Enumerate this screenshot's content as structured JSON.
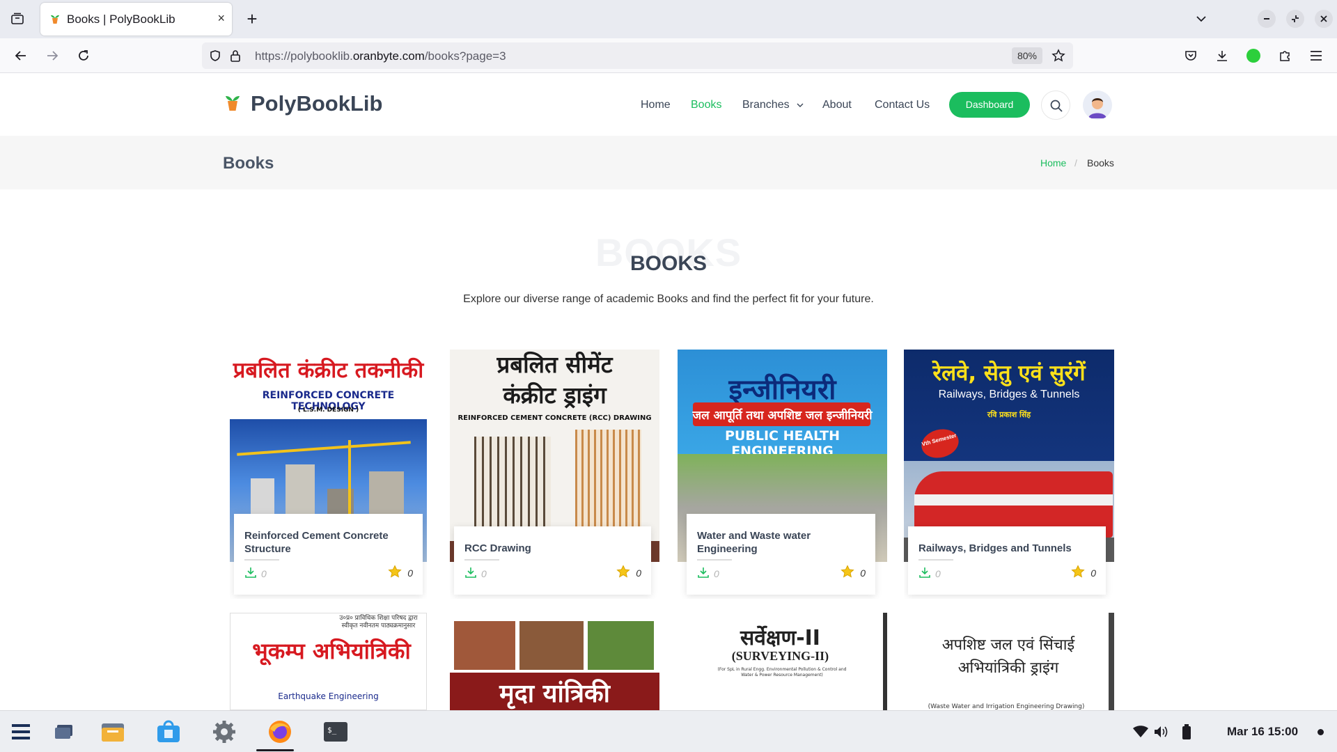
{
  "browser": {
    "tab_title": "Books | PolyBookLib",
    "tab_close": "×",
    "new_tab": "+",
    "url_prefix": "https://polybooklib.",
    "url_domain": "oranbyte.com",
    "url_path": "/books?page=3",
    "zoom": "80%"
  },
  "site": {
    "brand": "PolyBookLib",
    "nav": [
      "Home",
      "Books",
      "Branches",
      "About",
      "Contact Us"
    ],
    "active_nav": "Books",
    "dashboard_label": "Dashboard",
    "accent": "#1bbd5e"
  },
  "page": {
    "title": "Books",
    "breadcrumb": {
      "home": "Home",
      "sep": "/",
      "current": "Books"
    },
    "section_ghost": "BOOKS",
    "section_title": "BOOKS",
    "section_subtitle": "Explore our diverse range of academic Books and find the perfect fit for your future."
  },
  "books": [
    {
      "title": "Reinforced Cement Concrete Structure",
      "downloads": "0",
      "stars": "0",
      "cover_hindi": "प्रबलित कंक्रीट तकनीकी",
      "cover_english": "REINFORCED CONCRETE TECHNOLOGY",
      "cover_sub": "( L.S.M. DESIGN )"
    },
    {
      "title": "RCC Drawing",
      "downloads": "0",
      "stars": "0",
      "cover_hindi": "प्रबलित सीमेंट कंक्रीट ड्राइंग",
      "cover_english": "REINFORCED CEMENT CONCRETE (RCC) DRAWING"
    },
    {
      "title": "Water and Waste water Engineering",
      "downloads": "0",
      "stars": "0",
      "cover_hindi": "इन्जीनियरी",
      "cover_hindi2": "जल आपूर्ति तथा अपशिष्ट जल इन्जीनियरी",
      "cover_english": "PUBLIC HEALTH ENGINEERING"
    },
    {
      "title": "Railways, Bridges and Tunnels",
      "downloads": "0",
      "stars": "0",
      "cover_hindi": "रेलवे, सेतु एवं सुरंगें",
      "cover_english": "Railways, Bridges & Tunnels",
      "cover_author": "रवि प्रकाश सिंह",
      "cover_badge": "Vth Semester"
    }
  ],
  "books_row2": [
    {
      "cover_hindi": "भूकम्प अभियांत्रिकी",
      "cover_english": "Earthquake Engineering",
      "cover_top": "उ०प्र० प्राविधिक शिक्षा परिषद द्वारा स्वीकृत नवीनतम पाठ्यक्रमानुसार"
    },
    {
      "cover_hindi": "मृदा यांत्रिकी"
    },
    {
      "cover_hindi": "सर्वेक्षण-II",
      "cover_english": "(SURVEYING-II)",
      "cover_sub": "(For SpL in Rural Engg. Environmental Pollution & Control and Water & Power Resource Management)"
    },
    {
      "cover_hindi": "अपशिष्ट जल एवं सिंचाई अभियांत्रिकी ड्राइंग",
      "cover_english": "(Waste Water and Irrigation Engineering Drawing)"
    }
  ],
  "taskbar": {
    "clock": "Mar 16  15:00"
  }
}
